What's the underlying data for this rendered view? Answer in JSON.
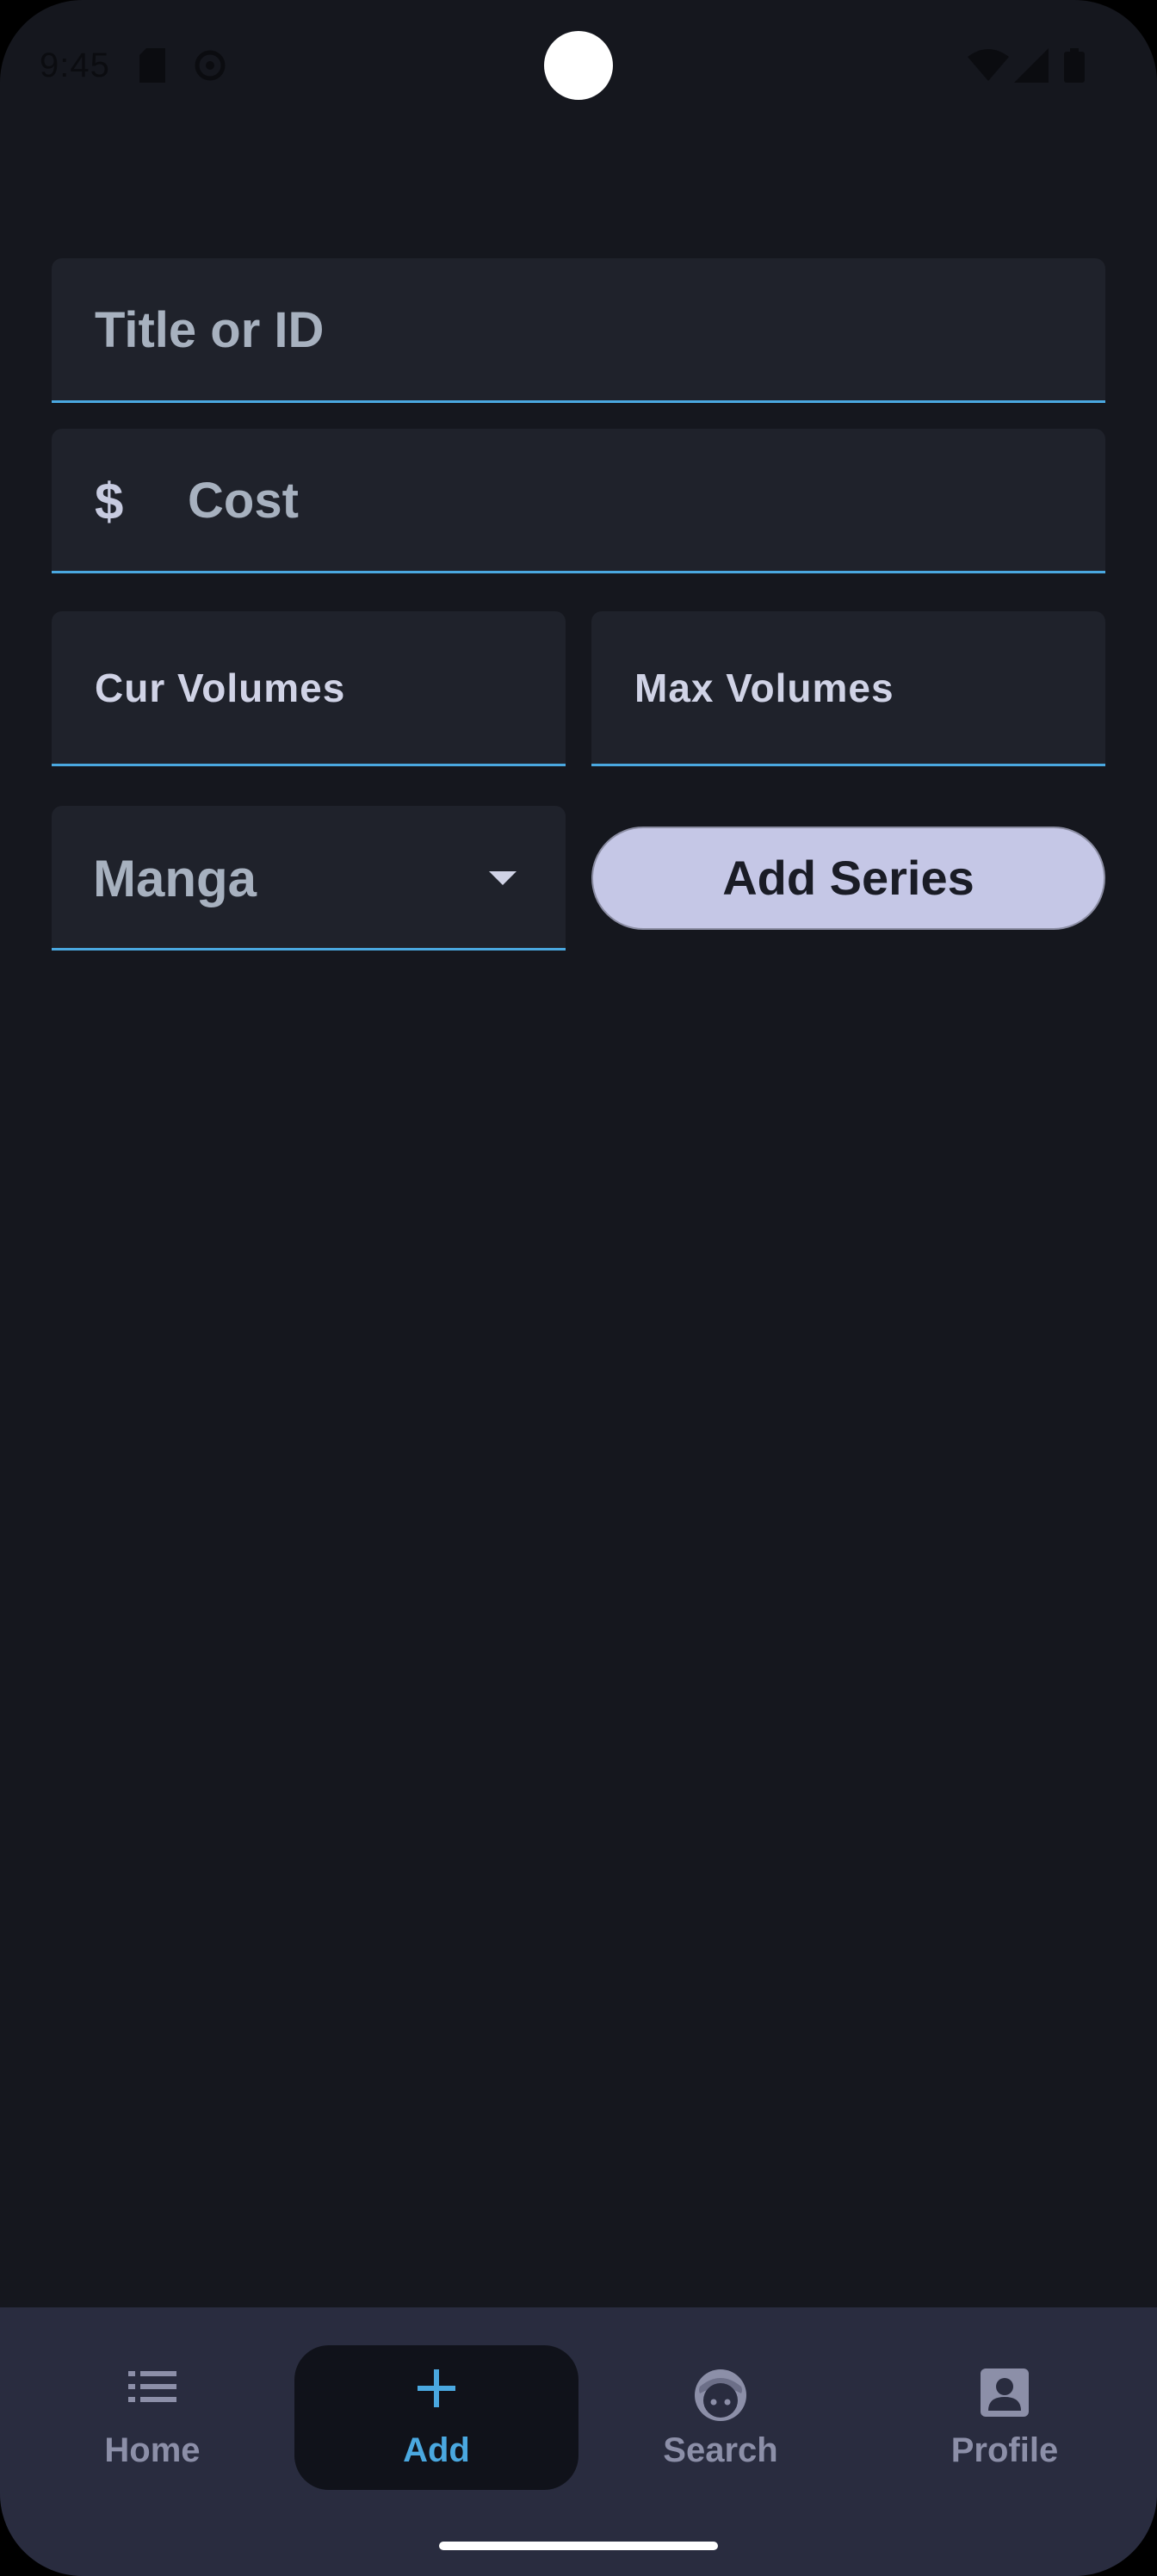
{
  "status_bar": {
    "time": "9:45"
  },
  "form": {
    "title_placeholder": "Title or ID",
    "cost_prefix": "$",
    "cost_placeholder": "Cost",
    "cur_volumes_placeholder": "Cur Volumes",
    "max_volumes_placeholder": "Max Volumes",
    "book_type_selected": "Manga",
    "add_button_label": "Add Series"
  },
  "nav": {
    "items": [
      {
        "label": "Home",
        "icon": "list-icon"
      },
      {
        "label": "Add",
        "icon": "plus-icon",
        "active": true
      },
      {
        "label": "Search",
        "icon": "face-icon"
      },
      {
        "label": "Profile",
        "icon": "profile-icon"
      }
    ]
  },
  "colors": {
    "background": "#15171e",
    "field": "#1f222b",
    "accent": "#4aa8e0",
    "button": "#c5c7e6",
    "nav_background": "#292c3f"
  }
}
